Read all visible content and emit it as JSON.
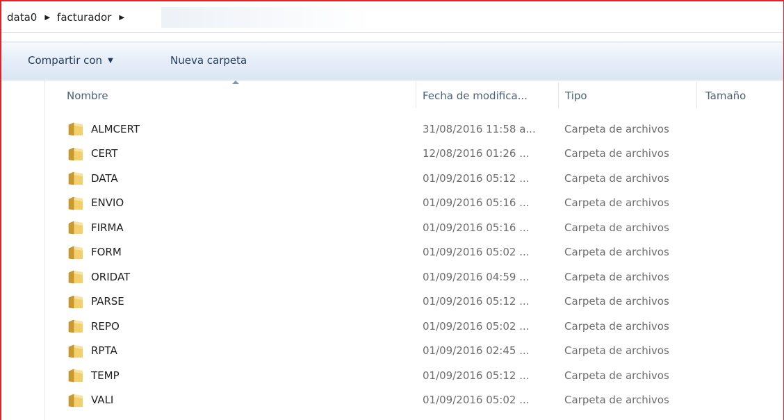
{
  "breadcrumb": {
    "items": [
      "data0",
      "facturador"
    ],
    "separator": "▶"
  },
  "toolbar": {
    "share_label": "Compartir con",
    "share_caret": "▼",
    "new_folder_label": "Nueva carpeta"
  },
  "columns": {
    "name": "Nombre",
    "date": "Fecha de modifica...",
    "type": "Tipo",
    "size": "Tamaño"
  },
  "files": [
    {
      "name": "ALMCERT",
      "date": "31/08/2016 11:58 a...",
      "type": "Carpeta de archivos"
    },
    {
      "name": "CERT",
      "date": "12/08/2016 01:26 ...",
      "type": "Carpeta de archivos"
    },
    {
      "name": "DATA",
      "date": "01/09/2016 05:12 ...",
      "type": "Carpeta de archivos"
    },
    {
      "name": "ENVIO",
      "date": "01/09/2016 05:16 ...",
      "type": "Carpeta de archivos"
    },
    {
      "name": "FIRMA",
      "date": "01/09/2016 05:16 ...",
      "type": "Carpeta de archivos"
    },
    {
      "name": "FORM",
      "date": "01/09/2016 05:02 ...",
      "type": "Carpeta de archivos"
    },
    {
      "name": "ORIDAT",
      "date": "01/09/2016 04:59 ...",
      "type": "Carpeta de archivos"
    },
    {
      "name": "PARSE",
      "date": "01/09/2016 05:12 ...",
      "type": "Carpeta de archivos"
    },
    {
      "name": "REPO",
      "date": "01/09/2016 05:02 ...",
      "type": "Carpeta de archivos"
    },
    {
      "name": "RPTA",
      "date": "01/09/2016 02:45 ...",
      "type": "Carpeta de archivos"
    },
    {
      "name": "TEMP",
      "date": "01/09/2016 05:12 ...",
      "type": "Carpeta de archivos"
    },
    {
      "name": "VALI",
      "date": "01/09/2016 05:02 ...",
      "type": "Carpeta de archivos"
    }
  ],
  "icons": {
    "folder": "folder-icon",
    "sort": "sort-ascending-icon"
  },
  "colors": {
    "window_border": "#d9262c",
    "toolbar_text": "#1e395b",
    "header_text": "#4c607a",
    "meta_text": "#6d6d6d",
    "folder_yellow": "#e8c15a"
  }
}
